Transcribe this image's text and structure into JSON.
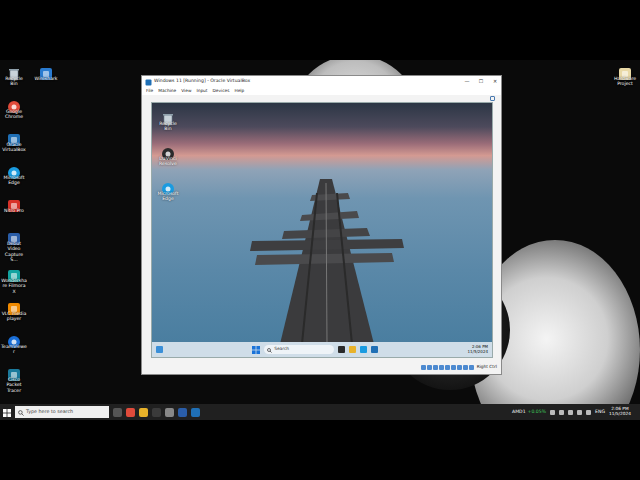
{
  "desktop": {
    "left_column": [
      {
        "label": "Recycle Bin"
      },
      {
        "label": "Google Chrome"
      },
      {
        "label": "Oracle VirtualBox"
      },
      {
        "label": "Microsoft Edge"
      },
      {
        "label": "Nitro Pro"
      },
      {
        "label": "Debut Video Capture S..."
      },
      {
        "label": "Wondershare Filmora X"
      },
      {
        "label": "VLC media player"
      },
      {
        "label": "TeamViewer"
      },
      {
        "label": "Cisco Packet Tracer"
      }
    ],
    "second_column": [
      {
        "label": "Wireshark"
      }
    ],
    "right_column": [
      {
        "label": "Hardware Project"
      }
    ]
  },
  "vm_window": {
    "title": "Windows 11 [Running] - Oracle VirtualBox",
    "controls": [
      "—",
      "☐",
      "✕"
    ],
    "menu": [
      "File",
      "Machine",
      "View",
      "Input",
      "Devices",
      "Help"
    ],
    "guest": {
      "icons": [
        {
          "label": "Recycle Bin"
        },
        {
          "label": "DaVinci Resolve"
        },
        {
          "label": "Microsoft Edge"
        }
      ],
      "taskbar": {
        "search_placeholder": "Search",
        "time": "2:06 PM",
        "date": "11/5/2024"
      }
    },
    "status_bar": {
      "host_key": "Right Ctrl"
    }
  },
  "taskbar": {
    "search_placeholder": "Type here to search",
    "widget": {
      "label": "AMD1",
      "change": "+0.05%"
    },
    "language": "ENG",
    "time": "2:06 PM",
    "date": "11/5/2024"
  }
}
